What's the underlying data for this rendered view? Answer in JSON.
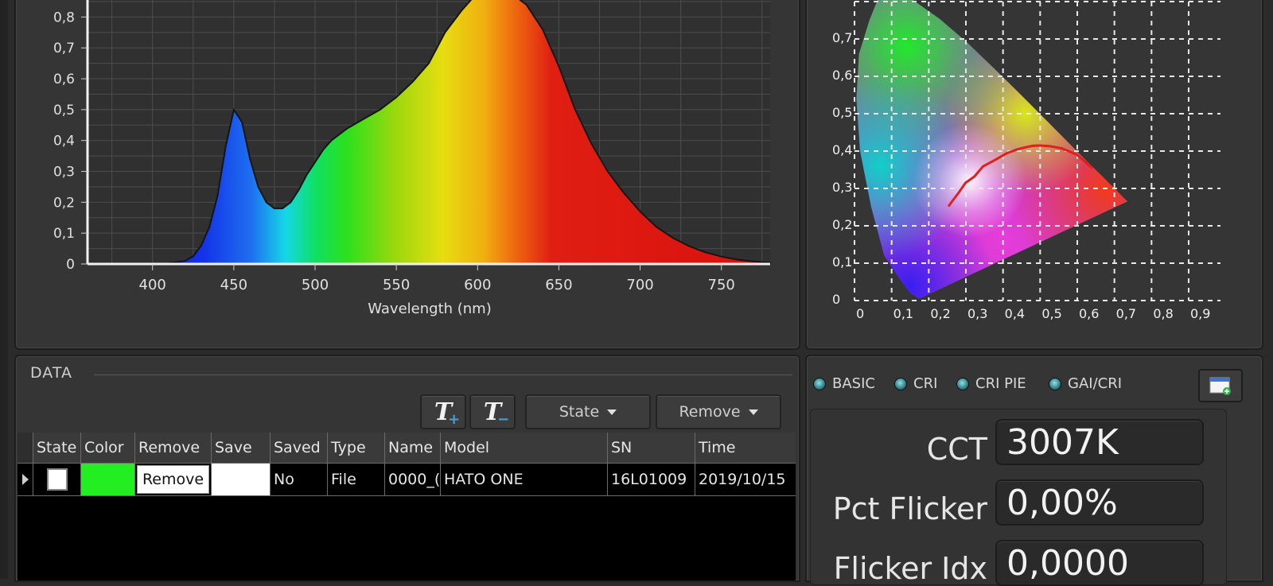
{
  "spectrum_chart": {
    "chart_data": {
      "type": "area",
      "xlabel": "Wavelength (nm)",
      "xlim": [
        360,
        780
      ],
      "ylim": [
        0,
        0.85
      ],
      "x_ticks": [
        "400",
        "450",
        "500",
        "550",
        "600",
        "650",
        "700",
        "750"
      ],
      "y_ticks": [
        "0",
        "0,1",
        "0,2",
        "0,3",
        "0,4",
        "0,5",
        "0,6",
        "0,7",
        "0,8"
      ],
      "grid": true,
      "series": [
        {
          "x": [
            360,
            380,
            400,
            410,
            420,
            425,
            430,
            435,
            440,
            445,
            450,
            455,
            460,
            465,
            470,
            475,
            480,
            485,
            490,
            495,
            500,
            505,
            510,
            520,
            530,
            540,
            550,
            560,
            570,
            575,
            580,
            590,
            600,
            610,
            620,
            630,
            640,
            650,
            660,
            670,
            680,
            690,
            700,
            710,
            720,
            730,
            740,
            750,
            760,
            770,
            780
          ],
          "values": [
            0.0,
            0.0,
            0.0,
            0.002,
            0.01,
            0.025,
            0.06,
            0.12,
            0.22,
            0.38,
            0.5,
            0.46,
            0.34,
            0.25,
            0.2,
            0.18,
            0.18,
            0.2,
            0.24,
            0.29,
            0.33,
            0.37,
            0.4,
            0.44,
            0.47,
            0.5,
            0.54,
            0.59,
            0.65,
            0.7,
            0.75,
            0.82,
            0.88,
            0.9,
            0.88,
            0.84,
            0.76,
            0.64,
            0.5,
            0.39,
            0.3,
            0.23,
            0.17,
            0.12,
            0.085,
            0.058,
            0.038,
            0.024,
            0.014,
            0.008,
            0.004
          ]
        }
      ]
    }
  },
  "cie_chart": {
    "chart_data": {
      "type": "scatter",
      "xlim": [
        0,
        0.9
      ],
      "ylim": [
        0,
        0.8
      ],
      "x_ticks": [
        "0",
        "0,1",
        "0,2",
        "0,3",
        "0,4",
        "0,5",
        "0,6",
        "0,7",
        "0,8",
        "0,9"
      ],
      "y_ticks": [
        "0",
        "0,1",
        "0,2",
        "0,3",
        "0,4",
        "0,5",
        "0,6",
        "0,7"
      ],
      "grid": true,
      "gamut_outline": {
        "x": [
          0.175,
          0.15,
          0.12,
          0.08,
          0.045,
          0.015,
          0.005,
          0.012,
          0.04,
          0.074,
          0.114,
          0.155,
          0.229,
          0.302,
          0.373,
          0.444,
          0.512,
          0.575,
          0.627,
          0.666,
          0.692,
          0.735
        ],
        "y": [
          0.005,
          0.02,
          0.06,
          0.12,
          0.25,
          0.4,
          0.54,
          0.66,
          0.75,
          0.834,
          0.826,
          0.806,
          0.754,
          0.692,
          0.624,
          0.555,
          0.487,
          0.424,
          0.372,
          0.334,
          0.308,
          0.265
        ]
      },
      "planckian_locus": {
        "x": [
          0.253,
          0.264,
          0.28,
          0.299,
          0.323,
          0.346,
          0.38,
          0.41,
          0.437,
          0.46,
          0.48,
          0.5,
          0.527,
          0.559,
          0.6,
          0.64
        ],
        "y": [
          0.252,
          0.267,
          0.288,
          0.315,
          0.332,
          0.359,
          0.377,
          0.394,
          0.404,
          0.41,
          0.414,
          0.415,
          0.413,
          0.407,
          0.39,
          0.355
        ]
      },
      "colors": {
        "locus": "#e0201c",
        "grid": "#e8e8e8"
      }
    }
  },
  "data_panel": {
    "title": "DATA",
    "toolbar": {
      "add_text_glyph": "T",
      "add_text_sub": "+",
      "remove_text_glyph": "T",
      "remove_text_sub": "−",
      "state_label": "State",
      "remove_label": "Remove"
    },
    "table": {
      "headers": [
        "State",
        "Color",
        "Remove",
        "Save",
        "Saved",
        "Type",
        "Name",
        "Model",
        "SN",
        "Time"
      ],
      "rows": [
        {
          "color_swatch": "#22ee22",
          "remove_label": "Remove",
          "saved": "No",
          "type": "File",
          "name": "0000_(",
          "model": "HATO ONE",
          "sn": "16L01009",
          "time": "2019/10/15"
        }
      ]
    }
  },
  "metrics_panel": {
    "modes": [
      "BASIC",
      "CRI",
      "CRI PIE",
      "GAI/CRI"
    ],
    "metrics": [
      {
        "label": "CCT",
        "value": "3007K"
      },
      {
        "label": "Pct Flicker",
        "value": "0,00%"
      },
      {
        "label": "Flicker Idx",
        "value": "0,0000"
      }
    ]
  }
}
